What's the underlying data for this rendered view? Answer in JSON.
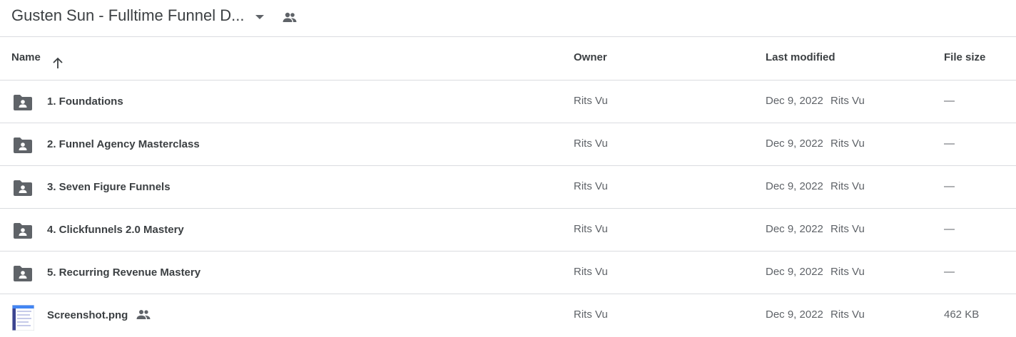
{
  "header": {
    "title": "Gusten Sun - Fulltime Funnel D...",
    "icons": [
      "dropdown-caret-icon",
      "shared-people-icon"
    ]
  },
  "columns": {
    "name": "Name",
    "owner": "Owner",
    "last_modified": "Last modified",
    "file_size": "File size",
    "sort_icon": "arrow-up-icon"
  },
  "files": [
    {
      "name": "1. Foundations",
      "type": "shared-folder",
      "owner": "Rits Vu",
      "modified_date": "Dec 9, 2022",
      "modified_by": "Rits Vu",
      "size": "—"
    },
    {
      "name": "2. Funnel Agency Masterclass",
      "type": "shared-folder",
      "owner": "Rits Vu",
      "modified_date": "Dec 9, 2022",
      "modified_by": "Rits Vu",
      "size": "—"
    },
    {
      "name": "3. Seven Figure Funnels",
      "type": "shared-folder",
      "owner": "Rits Vu",
      "modified_date": "Dec 9, 2022",
      "modified_by": "Rits Vu",
      "size": "—"
    },
    {
      "name": "4. Clickfunnels 2.0 Mastery",
      "type": "shared-folder",
      "owner": "Rits Vu",
      "modified_date": "Dec 9, 2022",
      "modified_by": "Rits Vu",
      "size": "—"
    },
    {
      "name": "5. Recurring Revenue Mastery",
      "type": "shared-folder",
      "owner": "Rits Vu",
      "modified_date": "Dec 9, 2022",
      "modified_by": "Rits Vu",
      "size": "—"
    },
    {
      "name": "Screenshot.png",
      "type": "image",
      "shared": true,
      "owner": "Rits Vu",
      "modified_date": "Dec 9, 2022",
      "modified_by": "Rits Vu",
      "size": "462 KB"
    }
  ],
  "colors": {
    "text_primary": "#3c4043",
    "text_secondary": "#5f6368",
    "divider": "#dadce0",
    "icon": "#5f6368"
  }
}
